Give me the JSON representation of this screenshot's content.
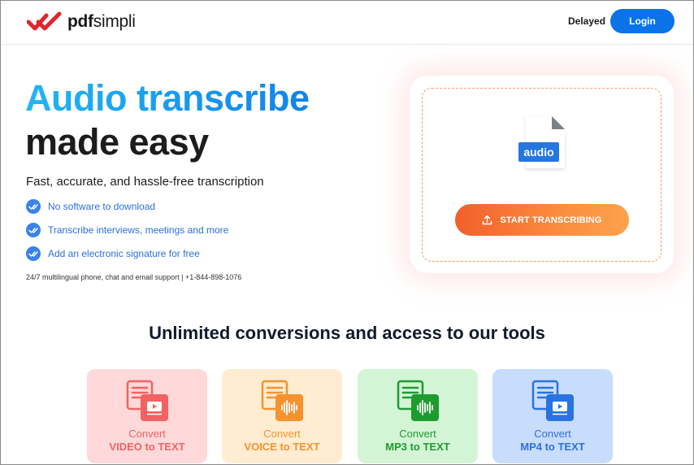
{
  "header": {
    "logo_text_bold": "pdf",
    "logo_text_regular": "simpli",
    "status_label": "Delayed",
    "login_label": "Login"
  },
  "hero": {
    "title_line1": "Audio transcribe",
    "title_line2": "made easy",
    "subtitle": "Fast, accurate, and hassle-free transcription",
    "features": [
      "No software to download",
      "Transcribe interviews, meetings and more",
      "Add an electronic signature for free"
    ],
    "support": "24/7 multilingual phone, chat and email support | +1-844-898-1076"
  },
  "upload": {
    "file_badge": "audio",
    "start_label": "START TRANSCRIBING"
  },
  "tools": {
    "title": "Unlimited conversions and access to our tools",
    "cards": [
      {
        "convert": "Convert",
        "name": "VIDEO to TEXT",
        "icon": "video-to-text-icon",
        "bg": "#ffd9d9",
        "accent": "#f26262"
      },
      {
        "convert": "Convert",
        "name": "VOICE to TEXT",
        "icon": "voice-to-text-icon",
        "bg": "#ffecd1",
        "accent": "#f5922d"
      },
      {
        "convert": "Convert",
        "name": "MP3 to TEXT",
        "icon": "mp3-to-text-icon",
        "bg": "#d3f5d6",
        "accent": "#1e9b2f"
      },
      {
        "convert": "Convert",
        "name": "MP4 to TEXT",
        "icon": "mp4-to-text-icon",
        "bg": "#c8dcfb",
        "accent": "#2a72e0"
      }
    ]
  },
  "colors": {
    "brand_blue": "#0a73e8",
    "title_gradient_start": "#23b6f3",
    "title_gradient_end": "#1183e8",
    "cta_orange": "#f25f2c",
    "logo_red": "#e0262c"
  }
}
